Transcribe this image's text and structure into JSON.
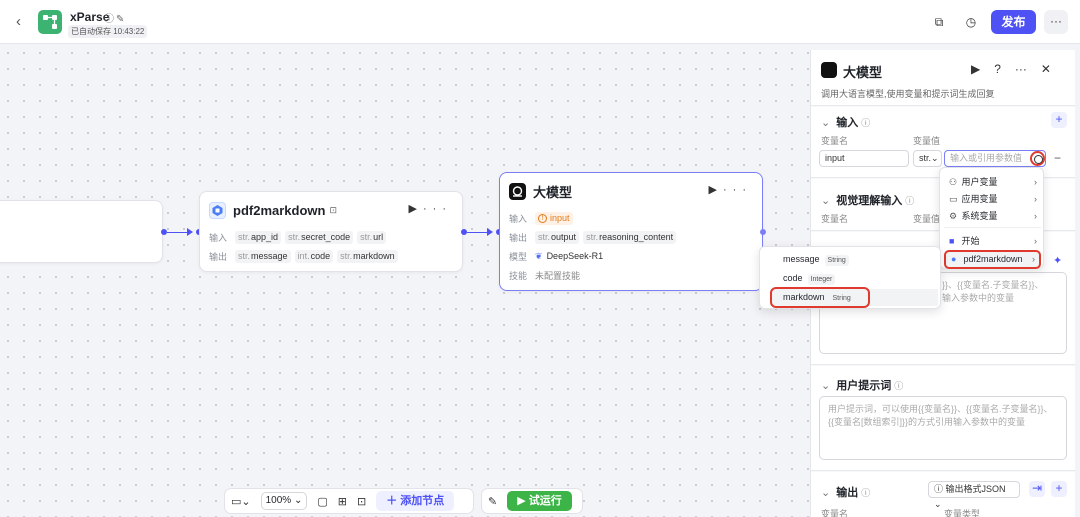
{
  "header": {
    "back_icon": "chevron-left-icon",
    "app_title": "xParse",
    "autosave": "已自动保存 10:43:22",
    "publish_label": "发布",
    "more_label": "···"
  },
  "nodes": {
    "pdf": {
      "title": "pdf2markdown",
      "input_label": "输入",
      "output_label": "输出",
      "inputs": [
        {
          "type": "str.",
          "name": "app_id"
        },
        {
          "type": "str.",
          "name": "secret_code"
        },
        {
          "type": "str.",
          "name": "url"
        }
      ],
      "outputs": [
        {
          "type": "str.",
          "name": "message"
        },
        {
          "type": "int.",
          "name": "code"
        },
        {
          "type": "str.",
          "name": "markdown"
        }
      ]
    },
    "llm": {
      "title": "大模型",
      "input_label": "输入",
      "input_value": "input",
      "output_label": "输出",
      "outputs": [
        {
          "type": "str.",
          "name": "output"
        },
        {
          "type": "str.",
          "name": "reasoning_content"
        }
      ],
      "model_label": "模型",
      "model_value": "DeepSeek-R1",
      "skill_label": "技能",
      "skill_value": "未配置技能"
    }
  },
  "bottombar": {
    "zoom": "100%",
    "add_node": "添加节点",
    "run": "试运行"
  },
  "panel": {
    "title": "大模型",
    "description": "调用大语言模型,使用变量和提示词生成回复",
    "input_section": "输入",
    "col_var_name": "变量名",
    "col_var_value": "变量值",
    "var_name_value": "input",
    "var_type": "str.",
    "var_value_placeholder": "输入或引用参数值",
    "vision_section": "视觉理解输入",
    "vision_col_name": "变量名",
    "vision_col_value": "变量值",
    "system_prompt_partial_1": "名}}、{{变量名.子变量名}}、",
    "system_prompt_partial_2": "用输入参数中的变量",
    "user_prompt_section": "用户提示词",
    "user_prompt_placeholder_1": "用户提示词，可以使用{{变量名}}、{{变量名.子变量名}}、",
    "user_prompt_placeholder_2": "{{变量名[数组索引]}}的方式引用输入参数中的变量",
    "output_section": "输出",
    "output_format": "输出格式JSON",
    "output_col_name": "变量名",
    "output_col_type": "变量类型"
  },
  "ref_menu": {
    "items": [
      {
        "label": "用户变量",
        "icon": "user-icon"
      },
      {
        "label": "应用变量",
        "icon": "folder-icon"
      },
      {
        "label": "系统变量",
        "icon": "gear-icon"
      }
    ],
    "nodes": [
      {
        "label": "开始",
        "icon": "start-icon"
      },
      {
        "label": "pdf2markdown",
        "icon": "node-icon"
      }
    ]
  },
  "sub_menu": {
    "items": [
      {
        "name": "message",
        "type": "String"
      },
      {
        "name": "code",
        "type": "Integer"
      },
      {
        "name": "markdown",
        "type": "String"
      }
    ]
  },
  "colors": {
    "accent": "#4e52f5",
    "run_green": "#3db448",
    "highlight_red": "#e03a2f",
    "app_logo": "#3cb371"
  }
}
